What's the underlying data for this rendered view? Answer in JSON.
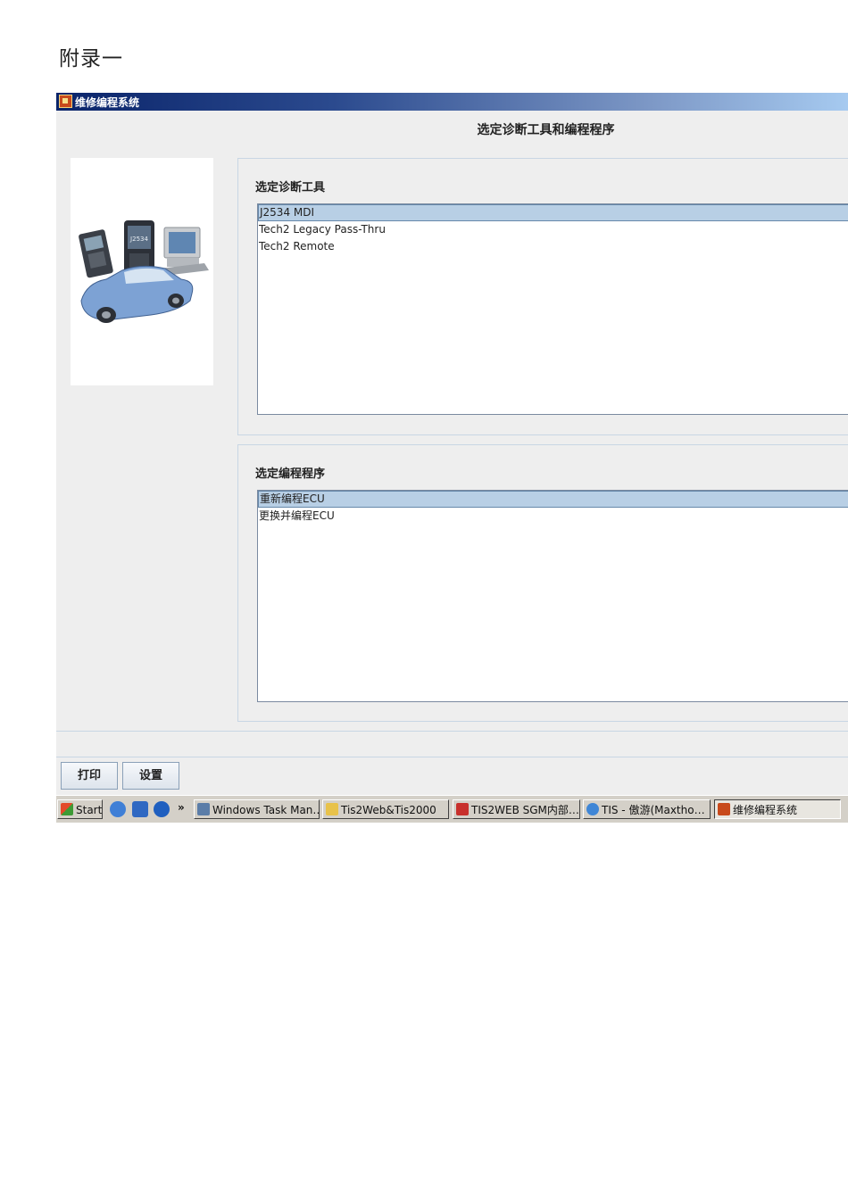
{
  "document": {
    "heading": "附录一"
  },
  "window": {
    "title": "维修编程系统",
    "header": "选定诊断工具和编程程序",
    "tool_group": {
      "label": "选定诊断工具",
      "items": [
        {
          "label": "J2534 MDI",
          "selected": true
        },
        {
          "label": "Tech2 Legacy Pass-Thru",
          "selected": false
        },
        {
          "label": "Tech2 Remote",
          "selected": false
        }
      ]
    },
    "program_group": {
      "label": "选定编程程序",
      "items": [
        {
          "label": "重新编程ECU",
          "selected": true
        },
        {
          "label": "更换并编程ECU",
          "selected": false
        }
      ]
    },
    "buttons": {
      "print": "打印",
      "settings": "设置"
    },
    "image_text": "J2534"
  },
  "taskbar": {
    "start": "Start",
    "chevron": "»",
    "items": [
      {
        "label": "Windows Task Man…",
        "icon": "monitor-icon"
      },
      {
        "label": "Tis2Web&Tis2000",
        "icon": "folder-icon"
      },
      {
        "label": "TIS2WEB SGM内部…",
        "icon": "pdf-icon"
      },
      {
        "label": "TIS - 傲游(Maxtho…",
        "icon": "browser-icon"
      },
      {
        "label": "维修编程系统",
        "icon": "app-icon"
      }
    ]
  }
}
